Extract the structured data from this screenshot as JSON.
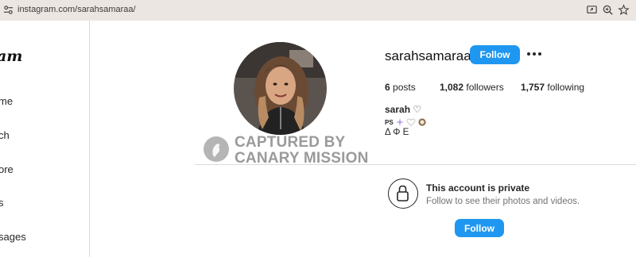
{
  "browser": {
    "url": "instagram.com/sarahsamaraa/",
    "icons": [
      "site-settings-icon",
      "screen-share-icon",
      "zoom-icon",
      "bookmark-star-icon"
    ]
  },
  "sidebar": {
    "logo": "am",
    "items": [
      {
        "label": "me",
        "icon": "home-icon"
      },
      {
        "label": "ch",
        "icon": "search-icon"
      },
      {
        "label": "ore",
        "icon": "explore-icon"
      },
      {
        "label": "s",
        "icon": "reels-icon"
      },
      {
        "label": "sages",
        "icon": "messages-icon"
      }
    ]
  },
  "profile": {
    "username": "sarahsamaraa",
    "follow_label": "Follow",
    "posts_count": "6",
    "posts_label": " posts",
    "followers_count": "1,082",
    "followers_label": " followers",
    "following_count": "1,757",
    "following_label": " following",
    "bio_name": "sarah ♡",
    "bio_line2_prefix": "PS",
    "bio_line3": "Δ Φ Ε"
  },
  "watermark": {
    "line1": "CAPTURED BY",
    "line2": "CANARY MISSION"
  },
  "private": {
    "title": "This account is private",
    "subtitle": "Follow to see their photos and videos.",
    "follow_label": "Follow"
  },
  "colors": {
    "accent": "#1f97f1",
    "url_bar": "#ece6e2",
    "border": "#dbdbdb"
  }
}
